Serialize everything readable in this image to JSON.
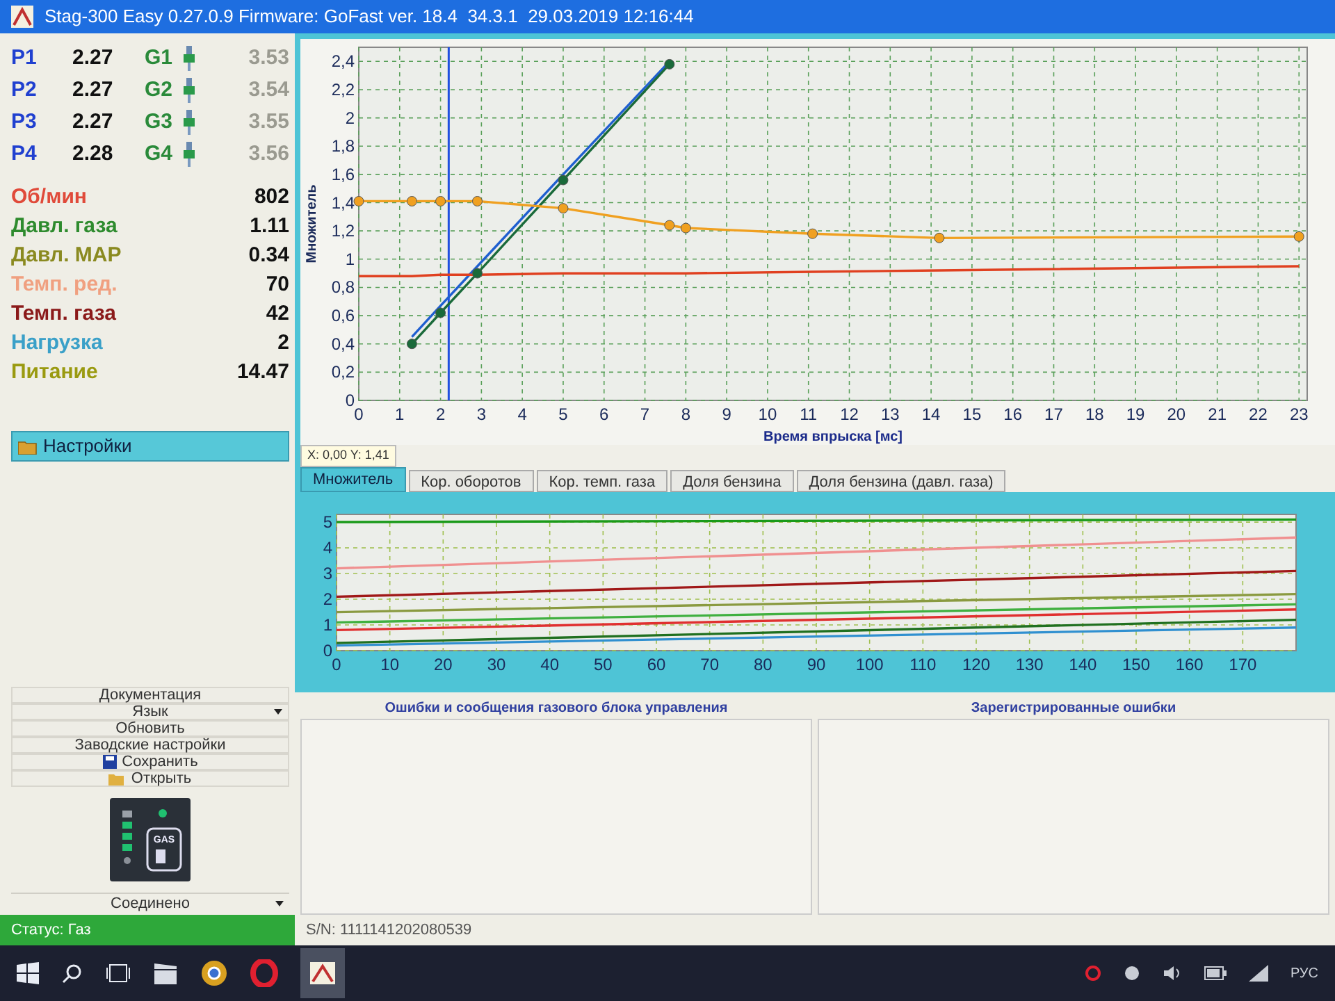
{
  "window": {
    "title": "Stag-300 Easy 0.27.0.9 Firmware: GoFast ver. 18.4  34.3.1  29.03.2019 12:16:44"
  },
  "channels": [
    {
      "p_label": "P1",
      "p_value": "2.27",
      "g_label": "G1",
      "g_value": "3.53"
    },
    {
      "p_label": "P2",
      "p_value": "2.27",
      "g_label": "G2",
      "g_value": "3.54"
    },
    {
      "p_label": "P3",
      "p_value": "2.27",
      "g_label": "G3",
      "g_value": "3.55"
    },
    {
      "p_label": "P4",
      "p_value": "2.28",
      "g_label": "G4",
      "g_value": "3.56"
    }
  ],
  "readings": [
    {
      "label": "Об/мин",
      "value": "802",
      "color": "#e04a3a"
    },
    {
      "label": "Давл. газа",
      "value": "1.11",
      "color": "#2e8b2e"
    },
    {
      "label": "Давл. MAP",
      "value": "0.34",
      "color": "#8a8a20"
    },
    {
      "label": "Темп. ред.",
      "value": "70",
      "color": "#f0a080"
    },
    {
      "label": "Темп. газа",
      "value": "42",
      "color": "#8b1a1a"
    },
    {
      "label": "Нагрузка",
      "value": "2",
      "color": "#3aa0c8"
    },
    {
      "label": "Питание",
      "value": "14.47",
      "color": "#9a9a10"
    }
  ],
  "settings_header": "Настройки",
  "menu": [
    {
      "label": "Документация",
      "kind": "plain"
    },
    {
      "label": "Язык",
      "kind": "dropdown"
    },
    {
      "label": "Обновить",
      "kind": "plain"
    },
    {
      "label": "Заводские настройки",
      "kind": "plain"
    },
    {
      "label": "Сохранить",
      "kind": "save"
    },
    {
      "label": "Открыть",
      "kind": "open"
    }
  ],
  "gas_indicator": {
    "label": "GAS"
  },
  "connection": "Соединено",
  "main_chart": {
    "cursor_readout": "X: 0,00  Y: 1,41",
    "chart_data": {
      "type": "line",
      "xlabel": "Время впрыска [мс]",
      "ylabel": "Множитель",
      "x": [
        0,
        1.3,
        2,
        2.9,
        5,
        7.6,
        8,
        11.1,
        14.2,
        23
      ],
      "series": [
        {
          "color": "#1f5fd0",
          "marker": "none",
          "values": [
            null,
            0.45,
            0.67,
            0.95,
            1.6,
            2.4,
            null,
            null,
            null,
            null
          ]
        },
        {
          "color": "#1a6a3a",
          "marker": "circle",
          "values": [
            null,
            0.4,
            0.62,
            0.9,
            1.56,
            2.38,
            null,
            null,
            null,
            null
          ]
        },
        {
          "color": "#f0a020",
          "marker": "circle",
          "values": [
            1.41,
            1.41,
            1.41,
            1.41,
            1.36,
            1.24,
            1.22,
            1.18,
            1.15,
            1.16
          ]
        },
        {
          "color": "#e04020",
          "marker": "none",
          "values": [
            0.88,
            0.88,
            0.89,
            0.89,
            0.9,
            0.9,
            0.9,
            0.91,
            0.92,
            0.95
          ]
        }
      ],
      "grid": true,
      "xlim": [
        0,
        23.2
      ],
      "ylim": [
        0,
        2.5
      ],
      "xticks": [
        0,
        1,
        2,
        3,
        4,
        5,
        6,
        7,
        8,
        9,
        10,
        11,
        12,
        13,
        14,
        15,
        16,
        17,
        18,
        19,
        20,
        21,
        22,
        23
      ],
      "yticks": [
        {
          "value": 0,
          "label": "0"
        },
        {
          "value": 0.2,
          "label": "0,2"
        },
        {
          "value": 0.4,
          "label": "0,4"
        },
        {
          "value": 0.6,
          "label": "0,6"
        },
        {
          "value": 0.8,
          "label": "0,8"
        },
        {
          "value": 1,
          "label": "1"
        },
        {
          "value": 1.2,
          "label": "1,2"
        },
        {
          "value": 1.4,
          "label": "1,4"
        },
        {
          "value": 1.6,
          "label": "1,6"
        },
        {
          "value": 1.8,
          "label": "1,8"
        },
        {
          "value": 2,
          "label": "2"
        },
        {
          "value": 2.2,
          "label": "2,2"
        },
        {
          "value": 2.4,
          "label": "2,4"
        }
      ],
      "ref_lines": [
        {
          "axis": "x",
          "value": 2.2,
          "color": "#2050e0"
        }
      ]
    }
  },
  "tabs": [
    {
      "label": "Множитель",
      "selected": true
    },
    {
      "label": "Кор. оборотов",
      "selected": false
    },
    {
      "label": "Кор. темп. газа",
      "selected": false
    },
    {
      "label": "Доля бензина",
      "selected": false
    },
    {
      "label": "Доля бензина (давл. газа)",
      "selected": false
    }
  ],
  "history_chart": {
    "chart_data": {
      "type": "line",
      "x": [
        0,
        180
      ],
      "series": [
        {
          "color": "#1a9a1a",
          "values": [
            5.0,
            5.1
          ]
        },
        {
          "color": "#f09090",
          "values": [
            3.2,
            4.4
          ]
        },
        {
          "color": "#a01818",
          "values": [
            2.1,
            3.1
          ]
        },
        {
          "color": "#8a9a40",
          "values": [
            1.5,
            2.2
          ]
        },
        {
          "color": "#40b040",
          "values": [
            1.1,
            1.8
          ]
        },
        {
          "color": "#e03030",
          "values": [
            0.8,
            1.6
          ]
        },
        {
          "color": "#207020",
          "values": [
            0.3,
            1.2
          ]
        },
        {
          "color": "#3090d0",
          "values": [
            0.2,
            0.9
          ]
        }
      ],
      "grid": true,
      "xlim": [
        0,
        180
      ],
      "ylim": [
        0,
        5.3
      ],
      "xticks": [
        0,
        10,
        20,
        30,
        40,
        50,
        60,
        70,
        80,
        90,
        100,
        110,
        120,
        130,
        140,
        150,
        160,
        170
      ],
      "yticks": [
        0,
        1,
        2,
        3,
        4,
        5
      ]
    }
  },
  "errors_panel": {
    "title": "Ошибки и сообщения газового блока управления"
  },
  "registered_errors": {
    "title": "Зарегистрированные ошибки"
  },
  "status_bar": {
    "status": "Статус: Газ",
    "serial": "S/N: 1111141202080539"
  },
  "taskbar": {
    "language": "РУС"
  }
}
